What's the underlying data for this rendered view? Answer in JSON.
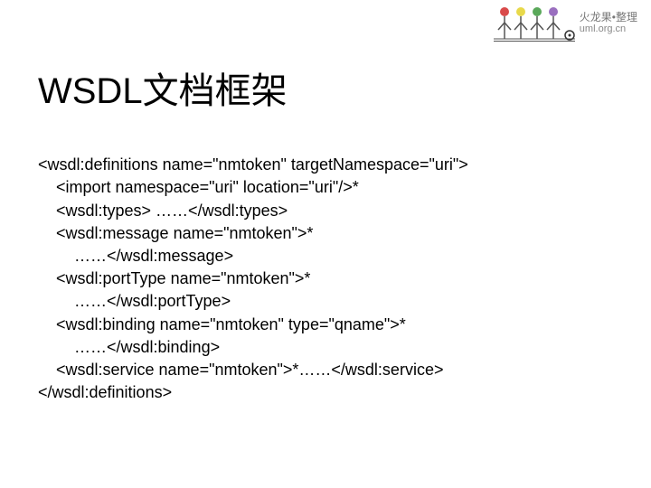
{
  "logo": {
    "brand": "火龙果•整理",
    "site": "uml.org.cn"
  },
  "title": "WSDL文档框架",
  "code": {
    "l1": "<wsdl:definitions name=\"nmtoken\" targetNamespace=\"uri\">",
    "l2": "    <import namespace=\"uri\" location=\"uri\"/>*",
    "l3": "    <wsdl:types> ……</wsdl:types>",
    "l4": "    <wsdl:message name=\"nmtoken\">*",
    "l5": "        ……</wsdl:message>",
    "l6": "    <wsdl:portType name=\"nmtoken\">*",
    "l7": "        ……</wsdl:portType>",
    "l8": "    <wsdl:binding name=\"nmtoken\" type=\"qname\">*",
    "l9": "        ……</wsdl:binding>",
    "l10": "    <wsdl:service name=\"nmtoken\">*……</wsdl:service>",
    "l11": "</wsdl:definitions>"
  }
}
